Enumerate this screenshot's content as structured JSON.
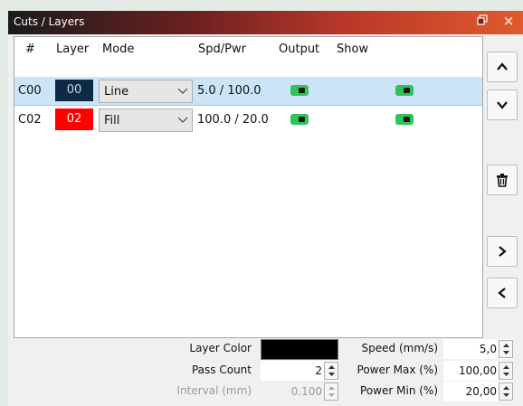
{
  "panel": {
    "title": "Cuts / Layers",
    "float_icon": "restore-icon",
    "close_label": "×"
  },
  "table": {
    "headers": [
      "#",
      "Layer",
      "Mode",
      "Spd/Pwr",
      "Output",
      "Show"
    ],
    "rows": [
      {
        "num": "C00",
        "layer": "00",
        "layer_color": "#0f2a45",
        "layer_text_color": "#c8d8ea",
        "mode": "Line",
        "spdpwr": "5.0 / 100.0",
        "output": true,
        "show": true,
        "selected": true
      },
      {
        "num": "C02",
        "layer": "02",
        "layer_color": "#ff0000",
        "layer_text_color": "#ffffff",
        "mode": "Fill",
        "spdpwr": "100.0 / 20.0",
        "output": true,
        "show": true,
        "selected": false
      }
    ]
  },
  "side_buttons": [
    "move-up-icon",
    "move-down-icon",
    "trash-icon",
    "chevron-right-icon",
    "chevron-left-icon"
  ],
  "settings": {
    "layer_color_label": "Layer Color",
    "layer_color": "#000000",
    "pass_count_label": "Pass Count",
    "pass_count": "2",
    "interval_label": "Interval (mm)",
    "interval": "0.100",
    "speed_label": "Speed (mm/s)",
    "speed": "5,0",
    "power_max_label": "Power Max (%)",
    "power_max": "100,00",
    "power_min_label": "Power Min (%)",
    "power_min": "20,00"
  },
  "colors": {
    "toggle_on": "#2ec45a",
    "selected_row": "#cce4f7"
  }
}
